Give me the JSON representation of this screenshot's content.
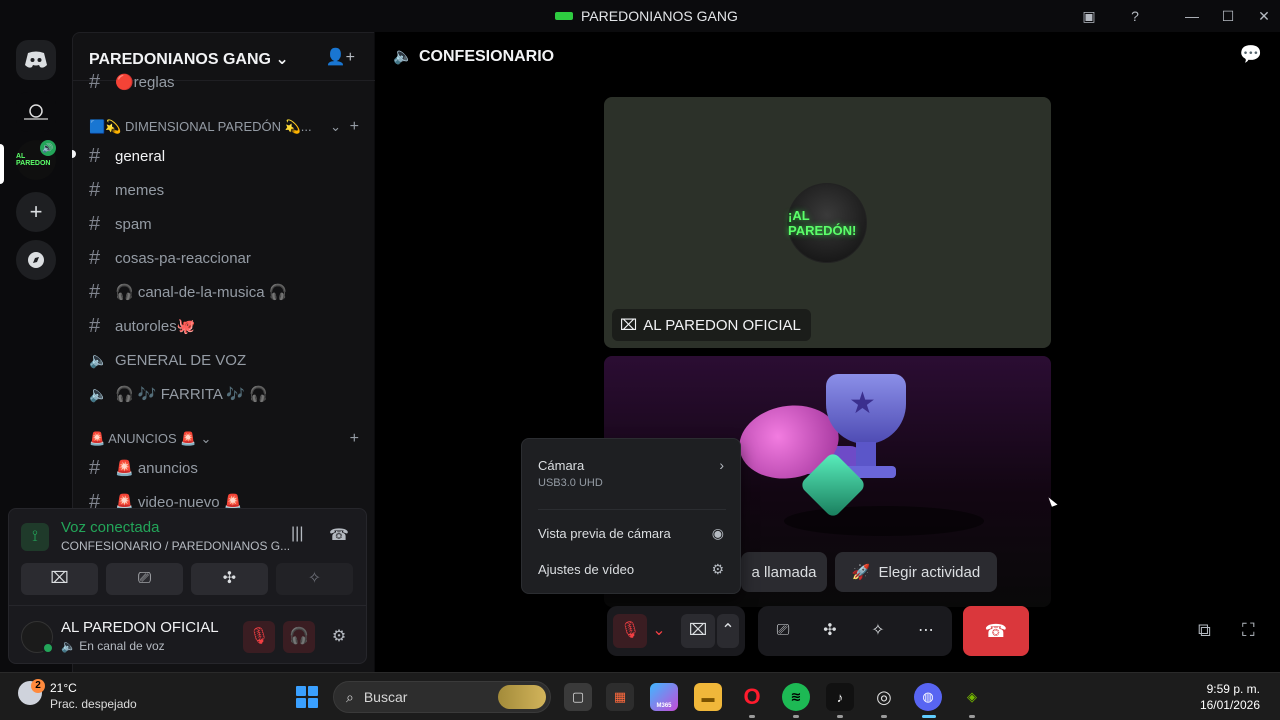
{
  "window": {
    "title": "PAREDONIANOS GANG"
  },
  "guild": {
    "name": "PAREDONIANOS GANG"
  },
  "channels": {
    "partial_top": "🔴reglas",
    "category1": {
      "label": "🟦💫 DIMENSIONAL PAREDÓN 💫..."
    },
    "items": [
      {
        "label": "general",
        "type": "text",
        "active": true
      },
      {
        "label": "memes",
        "type": "text"
      },
      {
        "label": "spam",
        "type": "text"
      },
      {
        "label": "cosas-pa-reaccionar",
        "type": "text"
      },
      {
        "label": "🎧 canal-de-la-musica 🎧",
        "type": "text"
      },
      {
        "label": "autoroles🐙",
        "type": "text"
      },
      {
        "label": "GENERAL DE VOZ",
        "type": "voice"
      },
      {
        "label": "🎧 🎶 FARRITA 🎶 🎧",
        "type": "voice"
      }
    ],
    "category2": {
      "label": "🚨 ANUNCIOS 🚨"
    },
    "items2": [
      {
        "label": "🚨 anuncios",
        "type": "text"
      },
      {
        "label": "🚨 video-nuevo 🚨",
        "type": "text"
      }
    ]
  },
  "voice_panel": {
    "status": "Voz conectada",
    "location": "CONFESIONARIO / PAREDONIANOS G...",
    "user_name": "AL PAREDON OFICIAL",
    "user_state": "En canal de voz"
  },
  "main": {
    "channel_title": "CONFESIONARIO",
    "tile1": {
      "label": "AL PAREDON OFICIAL",
      "avatar_text": "¡AL PAREDÓN!"
    },
    "tile_buttons": {
      "invite_label": "a llamada",
      "activity_label": "Elegir actividad"
    }
  },
  "popover": {
    "camera_label": "Cámara",
    "camera_device": "USB3.0 UHD",
    "preview_label": "Vista previa de cámara",
    "video_settings_label": "Ajustes de vídeo"
  },
  "taskbar": {
    "weather_temp": "21°C",
    "weather_desc": "Prac. despejado",
    "weather_badge": "2",
    "search_placeholder": "Buscar",
    "time": "9:59 p. m.",
    "date": "16/01/2026",
    "m365_label": "M365"
  },
  "colors": {
    "accent_green": "#23a559",
    "danger_red": "#da373c",
    "background": "#0b0b0d"
  }
}
